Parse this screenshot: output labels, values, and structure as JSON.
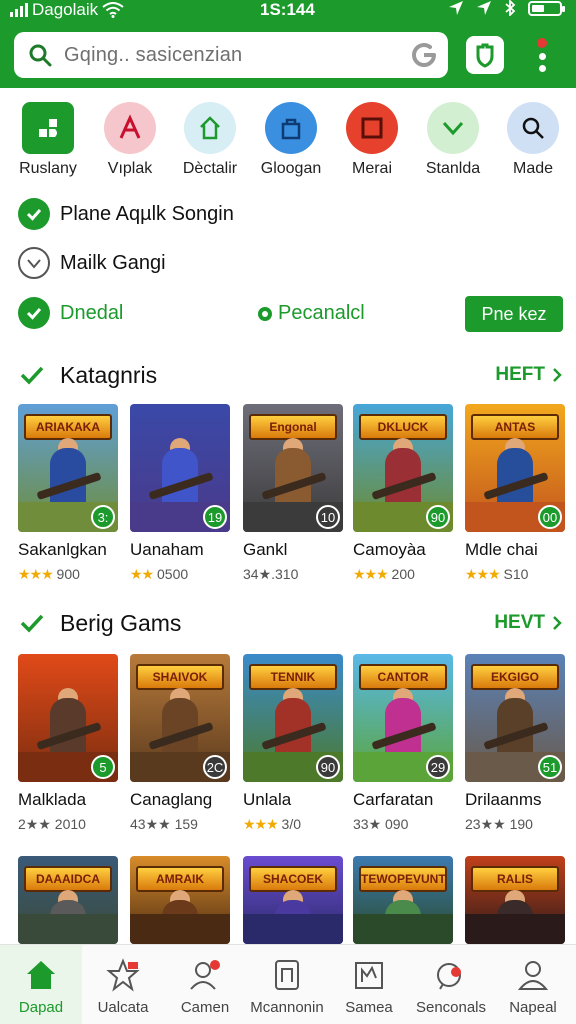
{
  "status": {
    "carrier": "Dagolaik",
    "time": "1S:144",
    "battery_level": 0.45
  },
  "search": {
    "placeholder": "Gqing.. sasicenzian"
  },
  "categories": [
    {
      "label": "Ruslany",
      "icon": "puzzle-icon",
      "color": "#1c9a2c"
    },
    {
      "label": "Vıplak",
      "icon": "letter-a-icon",
      "color": "#f5c7cc"
    },
    {
      "label": "Dèctalir",
      "icon": "home-icon",
      "color": "#d6eef4"
    },
    {
      "label": "Gloogan",
      "icon": "bag-icon",
      "color": "#3a8fe0"
    },
    {
      "label": "Merai",
      "icon": "square-icon",
      "color": "#e5412d"
    },
    {
      "label": "Stanlda",
      "icon": "chevron-down-icon",
      "color": "#d3efd1"
    },
    {
      "label": "Made",
      "icon": "search-icon",
      "color": "#cfe0f5"
    }
  ],
  "filters": {
    "item1": "Plane Aqµlk Songin",
    "item2": "Mailk Gangi",
    "item3": "Dnedal",
    "item4": "Pecanalcl",
    "button": "Pne kez"
  },
  "sections": [
    {
      "title": "Katagnris",
      "more": "HEFT",
      "cards": [
        {
          "name": "Sakanlgkan",
          "stars": "★★★",
          "rating": "900",
          "badge": "3:",
          "badge_style": "g",
          "banner": "ARIAKAKA",
          "sky": "#5f9fd8",
          "suit": "#2a4ca0",
          "ground": "#6f8d3a"
        },
        {
          "name": "Uanaham",
          "stars": "★★",
          "rating": "0500",
          "badge": "19",
          "badge_style": "g",
          "banner": "",
          "sky": "#3a49a8",
          "suit": "#3f55c9",
          "ground": "#4a3a8a"
        },
        {
          "name": "Gankl",
          "stars": "",
          "rating": "34★.310",
          "badge": "10",
          "badge_style": "d",
          "banner": "Engonal",
          "sky": "#6e6e7a",
          "suit": "#8a5a30",
          "ground": "#3b3b3b"
        },
        {
          "name": "Camoyàa",
          "stars": "★★★",
          "rating": "200",
          "badge": "90",
          "badge_style": "g",
          "banner": "DKLUCK",
          "sky": "#47a6d8",
          "suit": "#9a2f35",
          "ground": "#6e8a2e"
        },
        {
          "name": "Mdle chai",
          "stars": "★★★",
          "rating": "S10",
          "badge": "00",
          "badge_style": "g",
          "banner": "ANTAS",
          "sky": "#f2a81d",
          "suit": "#274e9a",
          "ground": "#c2541d"
        }
      ]
    },
    {
      "title": "Berig Gams",
      "more": "HEVT",
      "cards": [
        {
          "name": "Malklada",
          "stars": "",
          "rating": "2★★ 2010",
          "badge": "5",
          "badge_style": "g",
          "banner": "",
          "sky": "#e14a18",
          "suit": "#5a3a2a",
          "ground": "#7a2d10"
        },
        {
          "name": "Canaglang",
          "stars": "",
          "rating": "43★★ 159",
          "badge": "2C",
          "badge_style": "d",
          "banner": "SHAIVOK",
          "sky": "#b77a3a",
          "suit": "#6a4424",
          "ground": "#5a3a1e"
        },
        {
          "name": "Unlala",
          "stars": "★★★",
          "rating": "3/0",
          "badge": "90",
          "badge_style": "d",
          "banner": "TENNIK",
          "sky": "#3a8acb",
          "suit": "#a23228",
          "ground": "#4c7a2a"
        },
        {
          "name": "Carfaratan",
          "stars": "",
          "rating": "33★ 090",
          "badge": "29",
          "badge_style": "d",
          "banner": "CANTOR",
          "sky": "#59b8e8",
          "suit": "#c03090",
          "ground": "#5aa43a"
        },
        {
          "name": "Drilaanms",
          "stars": "",
          "rating": "23★★ 190",
          "badge": "51",
          "badge_style": "g",
          "banner": "EKGIGO",
          "sky": "#5a82b8",
          "suit": "#5b4029",
          "ground": "#6a5a4a"
        }
      ]
    },
    {
      "cards": [
        {
          "banner": "DAAAIDCA",
          "sky": "#3a5a78",
          "suit": "#5a5a5a",
          "ground": "#3a4a3a"
        },
        {
          "banner": "AMRAIK",
          "sky": "#d88c2a",
          "suit": "#6a3a1a",
          "ground": "#4a2a12"
        },
        {
          "banner": "SHACOEK",
          "sky": "#6a4cd0",
          "suit": "#4a3aa0",
          "ground": "#2a2a6a"
        },
        {
          "banner": "TEWOPEVUNT",
          "sky": "#3c7ab0",
          "suit": "#4a8a4a",
          "ground": "#2a4a2a"
        },
        {
          "banner": "RALIS",
          "sky": "#c0401a",
          "suit": "#3a2a2a",
          "ground": "#2a1a1a"
        }
      ]
    }
  ],
  "nav": [
    {
      "label": "Dapad",
      "icon": "home-icon"
    },
    {
      "label": "Ualcata",
      "icon": "star-icon"
    },
    {
      "label": "Camen",
      "icon": "person-icon"
    },
    {
      "label": "Mcannonin",
      "icon": "tablet-icon"
    },
    {
      "label": "Samea",
      "icon": "book-icon"
    },
    {
      "label": "Senconals",
      "icon": "chat-icon"
    },
    {
      "label": "Napeal",
      "icon": "profile-icon"
    }
  ],
  "colors": {
    "accent": "#1c9a2c",
    "alert": "#e53935"
  }
}
